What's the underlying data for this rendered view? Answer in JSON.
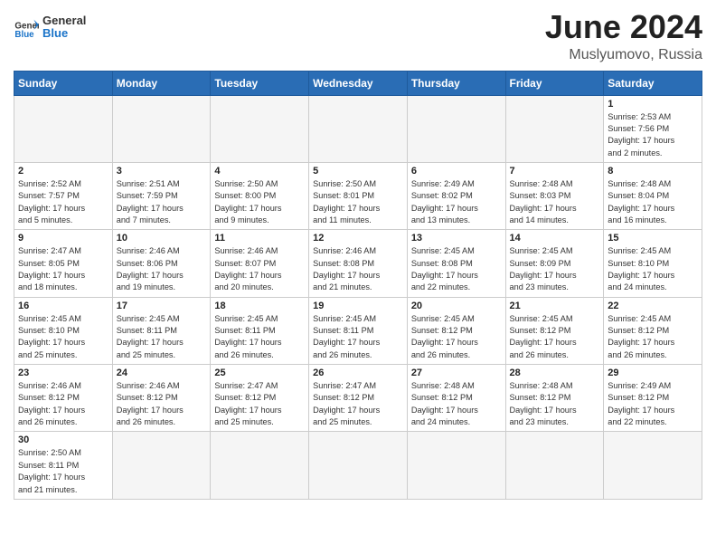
{
  "header": {
    "logo_general": "General",
    "logo_blue": "Blue",
    "month_year": "June 2024",
    "location": "Muslyumovo, Russia"
  },
  "weekdays": [
    "Sunday",
    "Monday",
    "Tuesday",
    "Wednesday",
    "Thursday",
    "Friday",
    "Saturday"
  ],
  "weeks": [
    [
      {
        "day": "",
        "info": ""
      },
      {
        "day": "",
        "info": ""
      },
      {
        "day": "",
        "info": ""
      },
      {
        "day": "",
        "info": ""
      },
      {
        "day": "",
        "info": ""
      },
      {
        "day": "",
        "info": ""
      },
      {
        "day": "1",
        "info": "Sunrise: 2:53 AM\nSunset: 7:56 PM\nDaylight: 17 hours\nand 2 minutes."
      }
    ],
    [
      {
        "day": "2",
        "info": "Sunrise: 2:52 AM\nSunset: 7:57 PM\nDaylight: 17 hours\nand 5 minutes."
      },
      {
        "day": "3",
        "info": "Sunrise: 2:51 AM\nSunset: 7:59 PM\nDaylight: 17 hours\nand 7 minutes."
      },
      {
        "day": "4",
        "info": "Sunrise: 2:50 AM\nSunset: 8:00 PM\nDaylight: 17 hours\nand 9 minutes."
      },
      {
        "day": "5",
        "info": "Sunrise: 2:50 AM\nSunset: 8:01 PM\nDaylight: 17 hours\nand 11 minutes."
      },
      {
        "day": "6",
        "info": "Sunrise: 2:49 AM\nSunset: 8:02 PM\nDaylight: 17 hours\nand 13 minutes."
      },
      {
        "day": "7",
        "info": "Sunrise: 2:48 AM\nSunset: 8:03 PM\nDaylight: 17 hours\nand 14 minutes."
      },
      {
        "day": "8",
        "info": "Sunrise: 2:48 AM\nSunset: 8:04 PM\nDaylight: 17 hours\nand 16 minutes."
      }
    ],
    [
      {
        "day": "9",
        "info": "Sunrise: 2:47 AM\nSunset: 8:05 PM\nDaylight: 17 hours\nand 18 minutes."
      },
      {
        "day": "10",
        "info": "Sunrise: 2:46 AM\nSunset: 8:06 PM\nDaylight: 17 hours\nand 19 minutes."
      },
      {
        "day": "11",
        "info": "Sunrise: 2:46 AM\nSunset: 8:07 PM\nDaylight: 17 hours\nand 20 minutes."
      },
      {
        "day": "12",
        "info": "Sunrise: 2:46 AM\nSunset: 8:08 PM\nDaylight: 17 hours\nand 21 minutes."
      },
      {
        "day": "13",
        "info": "Sunrise: 2:45 AM\nSunset: 8:08 PM\nDaylight: 17 hours\nand 22 minutes."
      },
      {
        "day": "14",
        "info": "Sunrise: 2:45 AM\nSunset: 8:09 PM\nDaylight: 17 hours\nand 23 minutes."
      },
      {
        "day": "15",
        "info": "Sunrise: 2:45 AM\nSunset: 8:10 PM\nDaylight: 17 hours\nand 24 minutes."
      }
    ],
    [
      {
        "day": "16",
        "info": "Sunrise: 2:45 AM\nSunset: 8:10 PM\nDaylight: 17 hours\nand 25 minutes."
      },
      {
        "day": "17",
        "info": "Sunrise: 2:45 AM\nSunset: 8:11 PM\nDaylight: 17 hours\nand 25 minutes."
      },
      {
        "day": "18",
        "info": "Sunrise: 2:45 AM\nSunset: 8:11 PM\nDaylight: 17 hours\nand 26 minutes."
      },
      {
        "day": "19",
        "info": "Sunrise: 2:45 AM\nSunset: 8:11 PM\nDaylight: 17 hours\nand 26 minutes."
      },
      {
        "day": "20",
        "info": "Sunrise: 2:45 AM\nSunset: 8:12 PM\nDaylight: 17 hours\nand 26 minutes."
      },
      {
        "day": "21",
        "info": "Sunrise: 2:45 AM\nSunset: 8:12 PM\nDaylight: 17 hours\nand 26 minutes."
      },
      {
        "day": "22",
        "info": "Sunrise: 2:45 AM\nSunset: 8:12 PM\nDaylight: 17 hours\nand 26 minutes."
      }
    ],
    [
      {
        "day": "23",
        "info": "Sunrise: 2:46 AM\nSunset: 8:12 PM\nDaylight: 17 hours\nand 26 minutes."
      },
      {
        "day": "24",
        "info": "Sunrise: 2:46 AM\nSunset: 8:12 PM\nDaylight: 17 hours\nand 26 minutes."
      },
      {
        "day": "25",
        "info": "Sunrise: 2:47 AM\nSunset: 8:12 PM\nDaylight: 17 hours\nand 25 minutes."
      },
      {
        "day": "26",
        "info": "Sunrise: 2:47 AM\nSunset: 8:12 PM\nDaylight: 17 hours\nand 25 minutes."
      },
      {
        "day": "27",
        "info": "Sunrise: 2:48 AM\nSunset: 8:12 PM\nDaylight: 17 hours\nand 24 minutes."
      },
      {
        "day": "28",
        "info": "Sunrise: 2:48 AM\nSunset: 8:12 PM\nDaylight: 17 hours\nand 23 minutes."
      },
      {
        "day": "29",
        "info": "Sunrise: 2:49 AM\nSunset: 8:12 PM\nDaylight: 17 hours\nand 22 minutes."
      }
    ],
    [
      {
        "day": "30",
        "info": "Sunrise: 2:50 AM\nSunset: 8:11 PM\nDaylight: 17 hours\nand 21 minutes."
      },
      {
        "day": "",
        "info": ""
      },
      {
        "day": "",
        "info": ""
      },
      {
        "day": "",
        "info": ""
      },
      {
        "day": "",
        "info": ""
      },
      {
        "day": "",
        "info": ""
      },
      {
        "day": "",
        "info": ""
      }
    ]
  ]
}
